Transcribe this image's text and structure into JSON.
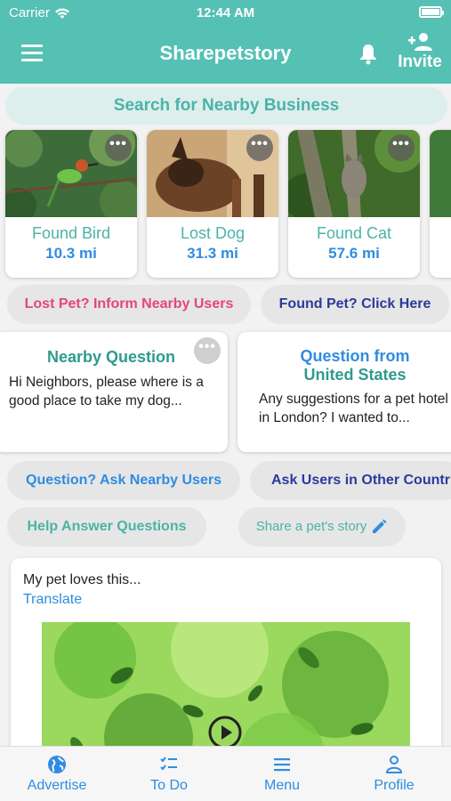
{
  "status": {
    "carrier": "Carrier",
    "time": "12:44 AM"
  },
  "header": {
    "title": "Sharepetstory",
    "invite_label": "Invite"
  },
  "search": {
    "label": "Search for Nearby Business"
  },
  "pets": [
    {
      "name": "Found Bird",
      "distance": "10.3 mi"
    },
    {
      "name": "Lost Dog",
      "distance": "31.3 mi"
    },
    {
      "name": "Found Cat",
      "distance": "57.6 mi"
    }
  ],
  "actions": {
    "lost_pet": "Lost Pet? Inform Nearby Users",
    "found_pet": "Found Pet? Click Here",
    "ask_nearby": "Question? Ask Nearby Users",
    "ask_other": "Ask Users in Other Countries",
    "help_answer": "Help Answer Questions",
    "share_story": "Share a pet's story"
  },
  "questions": [
    {
      "title": "Nearby Question",
      "body": "Hi Neighbors, please where is a good place to take my dog..."
    },
    {
      "title_line1": "Question from",
      "title_line2": "United States",
      "body": "Any suggestions for a pet hotel in London? I wanted to..."
    }
  ],
  "post": {
    "text": "My pet loves this...",
    "translate": "Translate"
  },
  "tabs": [
    {
      "label": "Advertise"
    },
    {
      "label": "To Do"
    },
    {
      "label": "Menu"
    },
    {
      "label": "Profile"
    }
  ],
  "colors": {
    "teal": "#55c0b4",
    "link_blue": "#2f8ce0",
    "pink": "#e5457a",
    "navy": "#2b3a9e"
  }
}
